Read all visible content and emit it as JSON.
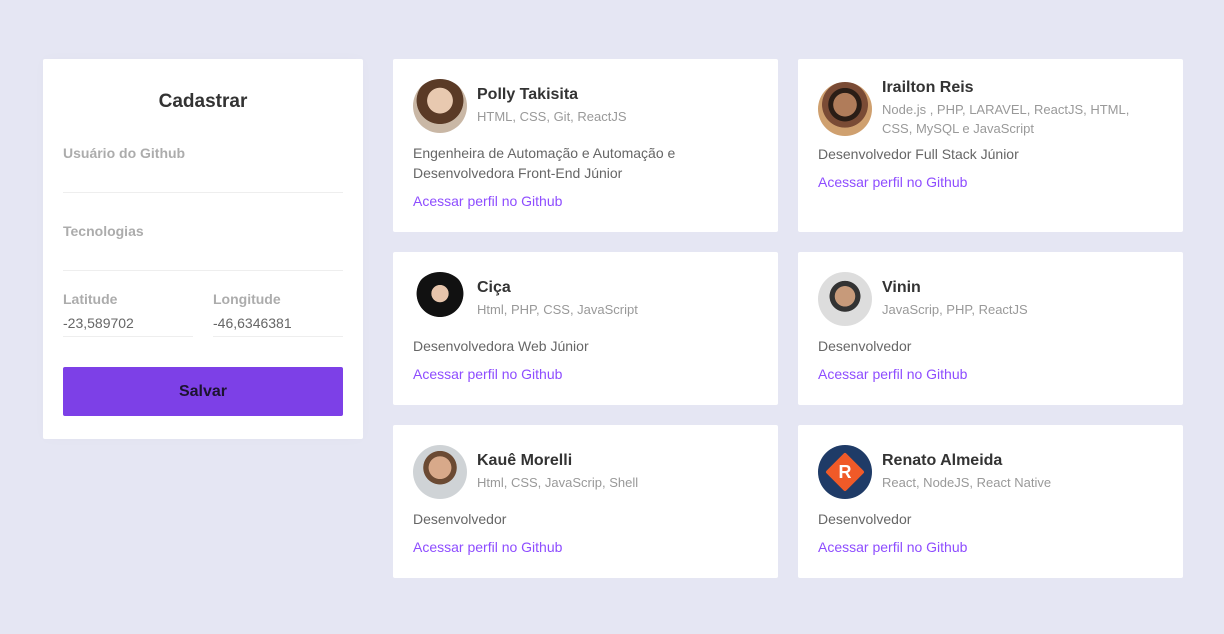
{
  "form": {
    "title": "Cadastrar",
    "github_label": "Usuário do Github",
    "github_value": "",
    "techs_label": "Tecnologias",
    "techs_value": "",
    "latitude_label": "Latitude",
    "latitude_value": "-23,589702",
    "longitude_label": "Longitude",
    "longitude_value": "-46,6346381",
    "save_label": "Salvar"
  },
  "devs": [
    {
      "name": "Polly Takisita",
      "techs": "HTML, CSS, Git, ReactJS",
      "bio": "Engenheira de Automação e Automação e Desenvolvedora Front-End Júnior",
      "link": "Acessar perfil no Github",
      "avatar": "avatar-photo"
    },
    {
      "name": "Irailton Reis",
      "techs": "Node.js , PHP, LARAVEL, ReactJS, HTML, CSS, MySQL e JavaScript",
      "bio": "Desenvolvedor Full Stack Júnior",
      "link": "Acessar perfil no Github",
      "avatar": "avatar-photo"
    },
    {
      "name": "Ciça",
      "techs": "Html, PHP, CSS, JavaScript",
      "bio": "Desenvolvedora Web Júnior",
      "link": "Acessar perfil no Github",
      "avatar": "avatar-photo"
    },
    {
      "name": "Vinin",
      "techs": "JavaScrip, PHP, ReactJS",
      "bio": "Desenvolvedor",
      "link": "Acessar perfil no Github",
      "avatar": "avatar-photo"
    },
    {
      "name": "Kauê Morelli",
      "techs": "Html, CSS, JavaScrip, Shell",
      "bio": "Desenvolvedor",
      "link": "Acessar perfil no Github",
      "avatar": "avatar-photo"
    },
    {
      "name": "Renato Almeida",
      "techs": "React, NodeJS, React Native",
      "bio": "Desenvolvedor",
      "link": "Acessar perfil no Github",
      "avatar": "avatar-logo-r"
    }
  ],
  "colors": {
    "background": "#e5e6f3",
    "accent": "#7d40e7",
    "link": "#8e4dff"
  }
}
